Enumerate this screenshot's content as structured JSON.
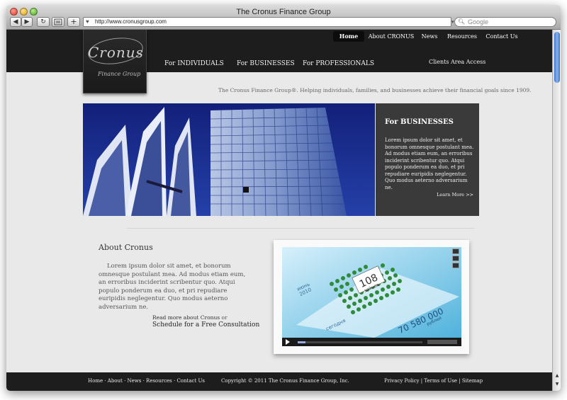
{
  "browser": {
    "title": "The Cronus Finance Group",
    "url": "http://www.cronusgroup.com",
    "search_placeholder": "Google",
    "back_glyph": "◀",
    "forward_glyph": "▶",
    "reload_glyph": "↻",
    "add_glyph": "+",
    "colors": {
      "scroll_thumb": "#3e73c8"
    }
  },
  "header": {
    "logo": {
      "word": "Cronus",
      "sub": "Finance Group"
    },
    "top_nav": [
      "Home",
      "About CRONUS",
      "News",
      "Resources",
      "Contact Us"
    ],
    "active_top_nav": "Home",
    "main_nav": [
      "For INDIVIDUALS",
      "For BUSINESSES",
      "For PROFESSIONALS"
    ],
    "clients_link": "Clients Area Access"
  },
  "tagline": "The Cronus Finance Group®. Helping individuals, families, and businesses achieve their financial goals since 1909.",
  "hero": {
    "panel_title": "For BUSINESSES",
    "panel_text": "Lorem ipsum dolor sit amet, et bonorum omnesque postulant mea. Ad modus etiam eum, an erroribus inciderint scribentur quo. Atqui populo ponderum ea duo, et pri repudiare euripidis neglegentur. Quo modus aeterno adversarium ne.",
    "learn_more": "Learn More >>"
  },
  "about": {
    "title": "About Cronus",
    "text": "Lorem ipsum dolor sit amet, et bonorum omnesque postulant mea. Ad modus etiam eum, an erroribus inciderint scribentur quo. Atqui populo ponderum ea duo, et pri repudiare euripidis neglegentur. Quo modus aeterno adversarium ne.",
    "read_more": "Read more about Cronus",
    "or": "or",
    "schedule": "Schedule for a Free Consultation"
  },
  "video": {
    "big_number": "108",
    "big_number_unit": "займов",
    "amount": "70 580 000",
    "amount_unit": "рублей",
    "year": "2010",
    "year_prefix": "июнь",
    "today": "сегодня",
    "progress": 0.06
  },
  "footer": {
    "links": "Home · About · News · Resources · Contact Us",
    "copyright": "Copyright © 2011 The Cronus Finance Group, Inc.",
    "legal": "Privacy Policy | Terms of Use | Sitemap"
  }
}
